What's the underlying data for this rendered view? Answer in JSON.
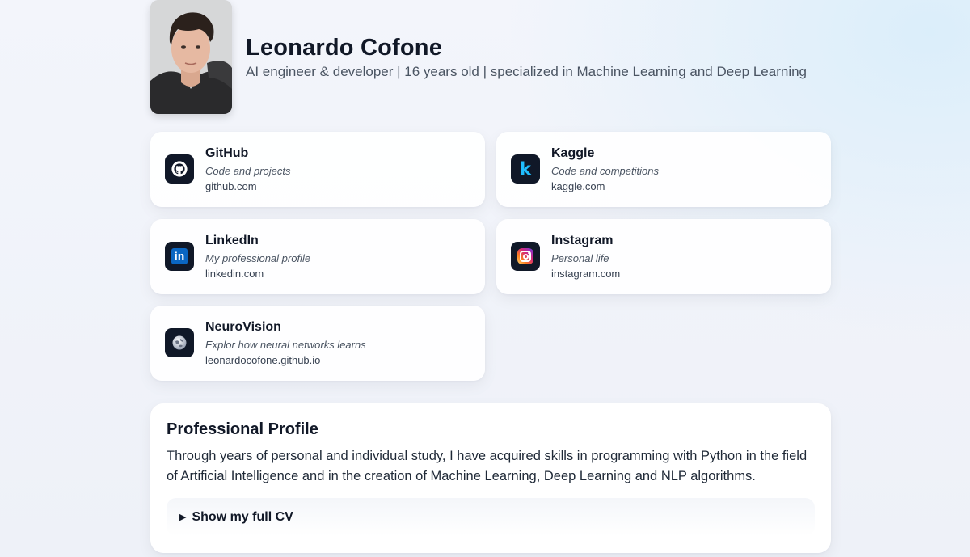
{
  "profile_header": {
    "name": "Leonardo Cofone",
    "tagline": "AI engineer & developer | 16 years old | specialized in Machine Learning and Deep Learning"
  },
  "links": [
    {
      "title": "GitHub",
      "description": "Code and projects",
      "url": "github.com",
      "icon": "github-icon"
    },
    {
      "title": "Kaggle",
      "description": "Code and competitions",
      "url": "kaggle.com",
      "icon": "kaggle-icon"
    },
    {
      "title": "LinkedIn",
      "description": "My professional profile",
      "url": "linkedin.com",
      "icon": "linkedin-icon"
    },
    {
      "title": "Instagram",
      "description": "Personal life",
      "url": "instagram.com",
      "icon": "instagram-icon"
    },
    {
      "title": "NeuroVision",
      "description": "Explor how neural networks learns",
      "url": "leonardocofone.github.io",
      "icon": "globe-icon"
    }
  ],
  "professional_profile": {
    "heading": "Professional Profile",
    "text": "Through years of personal and individual study, I have acquired skills in programming with Python in the field of Artificial Intelligence and in the creation of Machine Learning, Deep Learning and NLP algorithms.",
    "cv_toggle_label": "Show my full CV"
  },
  "colors": {
    "icon_background": "#101828",
    "kaggle_accent": "#20beff",
    "linkedin_accent": "#0a66c2"
  }
}
